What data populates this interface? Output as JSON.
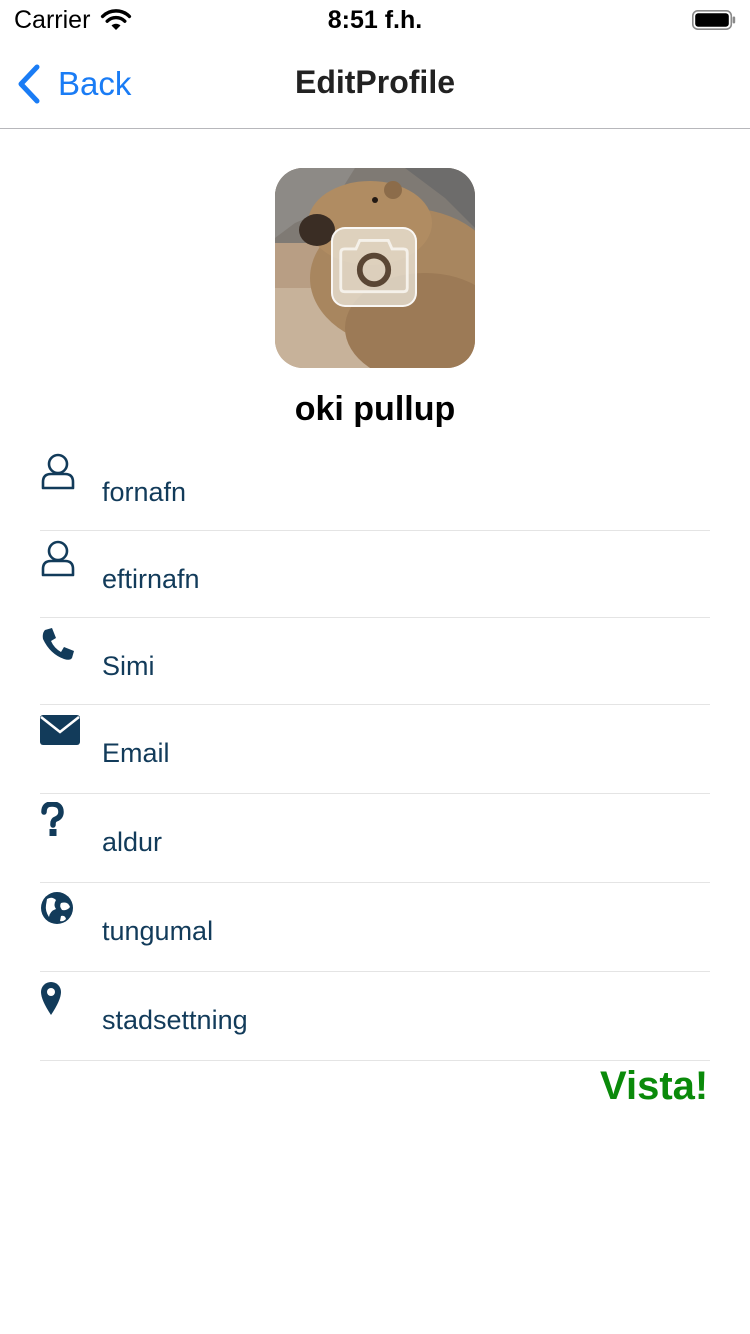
{
  "status_bar": {
    "carrier": "Carrier",
    "time": "8:51 f.h."
  },
  "nav": {
    "back_label": "Back",
    "title": "EditProfile"
  },
  "profile": {
    "display_name": "oki pullup"
  },
  "form": {
    "fields": [
      {
        "icon": "person-icon",
        "placeholder": "fornafn"
      },
      {
        "icon": "person-icon",
        "placeholder": "eftirnafn"
      },
      {
        "icon": "phone-icon",
        "placeholder": "Simi"
      },
      {
        "icon": "envelope-icon",
        "placeholder": "Email"
      },
      {
        "icon": "question-icon",
        "placeholder": "aldur"
      },
      {
        "icon": "globe-icon",
        "placeholder": "tungumal"
      },
      {
        "icon": "map-pin-icon",
        "placeholder": "stadsettning"
      }
    ]
  },
  "submit": {
    "label": "Vista!"
  },
  "colors": {
    "accent": "#1a7cf5",
    "icon": "#123b5a",
    "submit": "#0a8a0a",
    "divider": "#e4e4e4"
  }
}
